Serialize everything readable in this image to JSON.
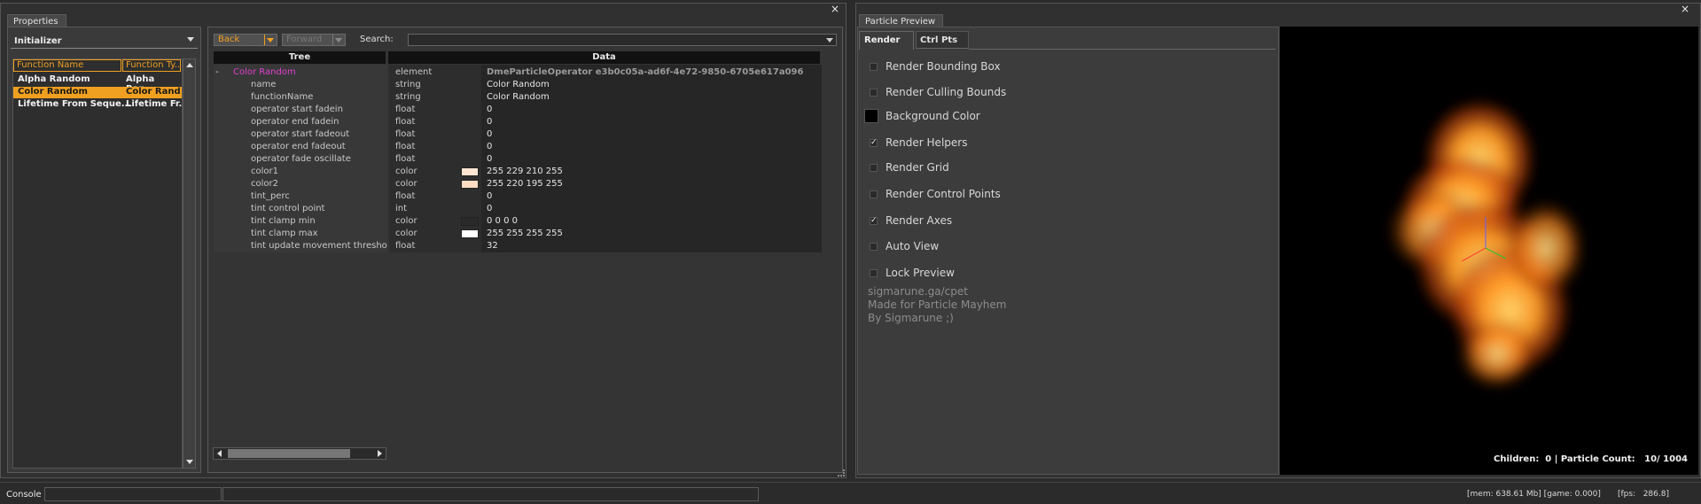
{
  "properties": {
    "tab_title": "Properties",
    "close_glyph": "×",
    "category_dropdown": "Initializer",
    "columns": [
      "Function Name",
      "Function Ty..."
    ],
    "functions": [
      {
        "name": "Alpha Random",
        "type": "Alpha Ran..."
      },
      {
        "name": "Color Random",
        "type": "Color Rand..."
      },
      {
        "name": "Lifetime From Seque...",
        "type": "Lifetime Fr..."
      }
    ]
  },
  "editor": {
    "back_label": "Back",
    "forward_label": "Forward",
    "search_label": "Search:",
    "search_value": "",
    "tree_header": "Tree",
    "data_header": "Data",
    "root": {
      "toggle": "-",
      "name": "Color Random",
      "type": "element",
      "value": "DmeParticleOperator e3b0c05a-ad6f-4e72-9850-6705e617a096"
    },
    "rows": [
      {
        "name": "name",
        "type": "string",
        "value": "Color Random"
      },
      {
        "name": "functionName",
        "type": "string",
        "value": "Color Random"
      },
      {
        "name": "operator start fadein",
        "type": "float",
        "value": "0"
      },
      {
        "name": "operator end fadein",
        "type": "float",
        "value": "0"
      },
      {
        "name": "operator start fadeout",
        "type": "float",
        "value": "0"
      },
      {
        "name": "operator end fadeout",
        "type": "float",
        "value": "0"
      },
      {
        "name": "operator fade oscillate",
        "type": "float",
        "value": "0"
      },
      {
        "name": "color1",
        "type": "color",
        "value": "255 229 210 255",
        "swatch": "#ffe5d2"
      },
      {
        "name": "color2",
        "type": "color",
        "value": "255 220 195 255",
        "swatch": "#ffdcc3"
      },
      {
        "name": "tint_perc",
        "type": "float",
        "value": "0"
      },
      {
        "name": "tint control point",
        "type": "int",
        "value": "0"
      },
      {
        "name": "tint clamp min",
        "type": "color",
        "value": "0 0 0 0",
        "swatch": "#2a2a2a"
      },
      {
        "name": "tint clamp max",
        "type": "color",
        "value": "255 255 255 255",
        "swatch": "#ffffff"
      },
      {
        "name": "tint update movement threshol",
        "type": "float",
        "value": "32"
      }
    ]
  },
  "preview": {
    "tab_title": "Particle Preview",
    "close_glyph": "×",
    "tabs": [
      "Render",
      "Ctrl Pts"
    ],
    "options": [
      {
        "label": "Render Bounding Box",
        "checked": false
      },
      {
        "label": "Render Culling Bounds",
        "checked": false
      },
      {
        "label": "Background Color",
        "is_color": true,
        "color": "#000000"
      },
      {
        "label": "Render Helpers",
        "checked": true
      },
      {
        "label": "Render Grid",
        "checked": false
      },
      {
        "label": "Render Control Points",
        "checked": false
      },
      {
        "label": "Render Axes",
        "checked": true
      },
      {
        "label": "Auto View",
        "checked": false
      },
      {
        "label": "Lock Preview",
        "checked": false
      }
    ],
    "credits": [
      "sigmarune.ga/cpet",
      "Made for Particle Mayhem",
      "By Sigmarune ;)"
    ],
    "stats": "Children:  0 | Particle Count:   10/ 1004",
    "check_glyph": "✓"
  },
  "statusbar": {
    "console_label": "Console",
    "mem": "[mem: 638.61 Mb] [game: 0.000]",
    "fps": "[fps:   286.8]"
  },
  "colors": {
    "accent": "#f0a020",
    "selection": "#f0a020",
    "root_name": "#e040d0"
  }
}
